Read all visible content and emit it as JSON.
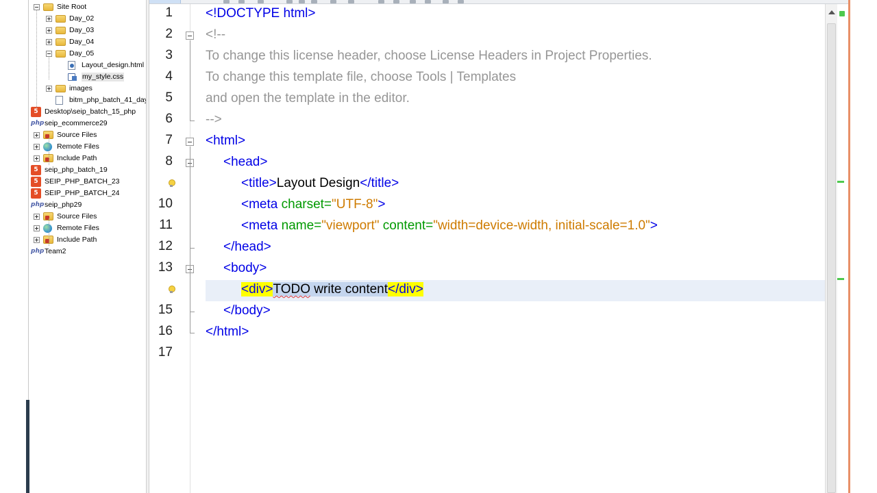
{
  "tree": {
    "items": [
      {
        "label": "Site Root",
        "icon": "folder-icon",
        "toggle": "minus",
        "indent": 1
      },
      {
        "label": "Day_02",
        "icon": "folder-icon",
        "toggle": "plus",
        "indent": 2
      },
      {
        "label": "Day_03",
        "icon": "folder-icon",
        "toggle": "plus",
        "indent": 2
      },
      {
        "label": "Day_04",
        "icon": "folder-icon",
        "toggle": "plus",
        "indent": 2
      },
      {
        "label": "Day_05",
        "icon": "folder-icon",
        "toggle": "minus",
        "indent": 2
      },
      {
        "label": "Layout_design.html",
        "icon": "html-file-icon",
        "toggle": "",
        "indent": 3
      },
      {
        "label": "my_style.css",
        "icon": "css-file-icon",
        "toggle": "",
        "indent": 3,
        "selected": true
      },
      {
        "label": "images",
        "icon": "folder-icon",
        "toggle": "plus",
        "indent": 2
      },
      {
        "label": "bitm_php_batch_41_day",
        "icon": "file-icon",
        "toggle": "",
        "indent": 2
      },
      {
        "label": "Desktop\\seip_batch_15_php",
        "icon": "html5-project-icon",
        "toggle": "",
        "indent": 0
      },
      {
        "label": "seip_ecommerce29",
        "icon": "php-project-icon",
        "toggle": "",
        "indent": 0
      },
      {
        "label": "Source Files",
        "icon": "source-files-icon",
        "toggle": "plus",
        "indent": 1
      },
      {
        "label": "Remote Files",
        "icon": "globe-icon",
        "toggle": "plus",
        "indent": 1
      },
      {
        "label": "Include Path",
        "icon": "source-files-icon",
        "toggle": "plus",
        "indent": 1
      },
      {
        "label": "seip_php_batch_19",
        "icon": "html5-project-icon",
        "toggle": "",
        "indent": 0
      },
      {
        "label": "SEIP_PHP_BATCH_23",
        "icon": "html5-project-icon",
        "toggle": "",
        "indent": 0
      },
      {
        "label": "SEIP_PHP_BATCH_24",
        "icon": "html5-project-icon",
        "toggle": "",
        "indent": 0
      },
      {
        "label": "seip_php29",
        "icon": "php-project-icon",
        "toggle": "",
        "indent": 0
      },
      {
        "label": "Source Files",
        "icon": "source-files-icon",
        "toggle": "plus",
        "indent": 1
      },
      {
        "label": "Remote Files",
        "icon": "globe-icon",
        "toggle": "plus",
        "indent": 1
      },
      {
        "label": "Include Path",
        "icon": "source-files-icon",
        "toggle": "plus",
        "indent": 1
      },
      {
        "label": "Team2",
        "icon": "php-project-icon",
        "toggle": "",
        "indent": 0
      }
    ]
  },
  "editor": {
    "current_line": 14,
    "lines": [
      {
        "no": "1",
        "tokens": [
          {
            "t": "<!DOCTYPE html>",
            "c": "tag"
          }
        ],
        "indent": 0
      },
      {
        "no": "2",
        "tokens": [
          {
            "t": "<!--",
            "c": "cmt"
          }
        ],
        "indent": 0
      },
      {
        "no": "3",
        "tokens": [
          {
            "t": "To change this license header, choose License Headers in Project Properties.",
            "c": "cmt"
          }
        ],
        "indent": 0
      },
      {
        "no": "4",
        "tokens": [
          {
            "t": "To change this template file, choose Tools | Templates",
            "c": "cmt"
          }
        ],
        "indent": 0
      },
      {
        "no": "5",
        "tokens": [
          {
            "t": "and open the template in the editor.",
            "c": "cmt"
          }
        ],
        "indent": 0
      },
      {
        "no": "6",
        "tokens": [
          {
            "t": "-->",
            "c": "cmt"
          }
        ],
        "indent": 0
      },
      {
        "no": "7",
        "tokens": [
          {
            "t": "<html>",
            "c": "tag"
          }
        ],
        "indent": 0
      },
      {
        "no": "8",
        "tokens": [
          {
            "t": "<head>",
            "c": "tag"
          }
        ],
        "indent": 1
      },
      {
        "no": "",
        "hint": true,
        "tokens": [
          {
            "t": "<title>",
            "c": "tag"
          },
          {
            "t": "Layout Design",
            "c": "txt"
          },
          {
            "t": "</title>",
            "c": "tag"
          }
        ],
        "indent": 2
      },
      {
        "no": "10",
        "tokens": [
          {
            "t": "<meta ",
            "c": "tag"
          },
          {
            "t": "charset=",
            "c": "attr"
          },
          {
            "t": "\"UTF-8\"",
            "c": "val"
          },
          {
            "t": ">",
            "c": "tag"
          }
        ],
        "indent": 2
      },
      {
        "no": "11",
        "tokens": [
          {
            "t": "<meta ",
            "c": "tag"
          },
          {
            "t": "name=",
            "c": "attr"
          },
          {
            "t": "\"viewport\"",
            "c": "val"
          },
          {
            "t": " content=",
            "c": "attr"
          },
          {
            "t": "\"width=device-width, initial-scale=1.0\"",
            "c": "val"
          },
          {
            "t": ">",
            "c": "tag"
          }
        ],
        "indent": 2
      },
      {
        "no": "12",
        "tokens": [
          {
            "t": "</head>",
            "c": "tag"
          }
        ],
        "indent": 1
      },
      {
        "no": "13",
        "tokens": [
          {
            "t": "<body>",
            "c": "tag"
          }
        ],
        "indent": 1
      },
      {
        "no": "",
        "hint": true,
        "tokens": [
          {
            "t": "<div>",
            "c": "tag hl-tag"
          },
          {
            "t": "TODO",
            "c": "txt sq sel"
          },
          {
            "t": " write content",
            "c": "txt sel"
          },
          {
            "t": "</div>",
            "c": "tag hl-tag"
          }
        ],
        "indent": 2
      },
      {
        "no": "15",
        "tokens": [
          {
            "t": "</body>",
            "c": "tag"
          }
        ],
        "indent": 1
      },
      {
        "no": "16",
        "tokens": [
          {
            "t": "</html>",
            "c": "tag"
          }
        ],
        "indent": 0
      },
      {
        "no": "17",
        "tokens": [],
        "indent": 0
      }
    ]
  },
  "colors": {
    "tag": "#0000e6",
    "attribute": "#009900",
    "value": "#ce7b00",
    "comment": "#969696",
    "tag_match_highlight": "#ffff00",
    "current_line": "#e9eff8",
    "selection": "#c4d5ee",
    "window_accent": "#e89068"
  }
}
